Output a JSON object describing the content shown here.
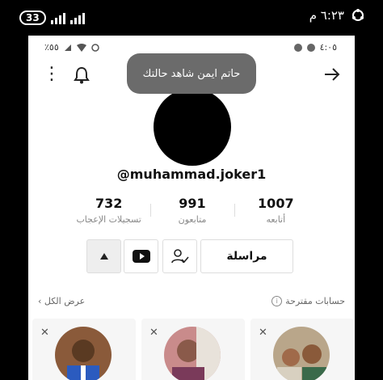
{
  "outer_status": {
    "battery": "33",
    "time": "٦:٢٣ م"
  },
  "inner_status": {
    "battery": "٪٥٥",
    "time": "٤:٠٥"
  },
  "toast": "حاتم ايمن شاهد حالتك",
  "profile": {
    "username": "@muhammad.joker1"
  },
  "stats": [
    {
      "value": "732",
      "label": "تسجيلات الإعجاب"
    },
    {
      "value": "991",
      "label": "متابعون"
    },
    {
      "value": "1007",
      "label": "أتابعه"
    }
  ],
  "actions": {
    "message_label": "مراسلة"
  },
  "suggested": {
    "title": "حسابات مقترحة",
    "view_all": "عرض الكل"
  },
  "colors": {
    "toast_bg": "#6b6b6b",
    "avatar": "#000000"
  }
}
